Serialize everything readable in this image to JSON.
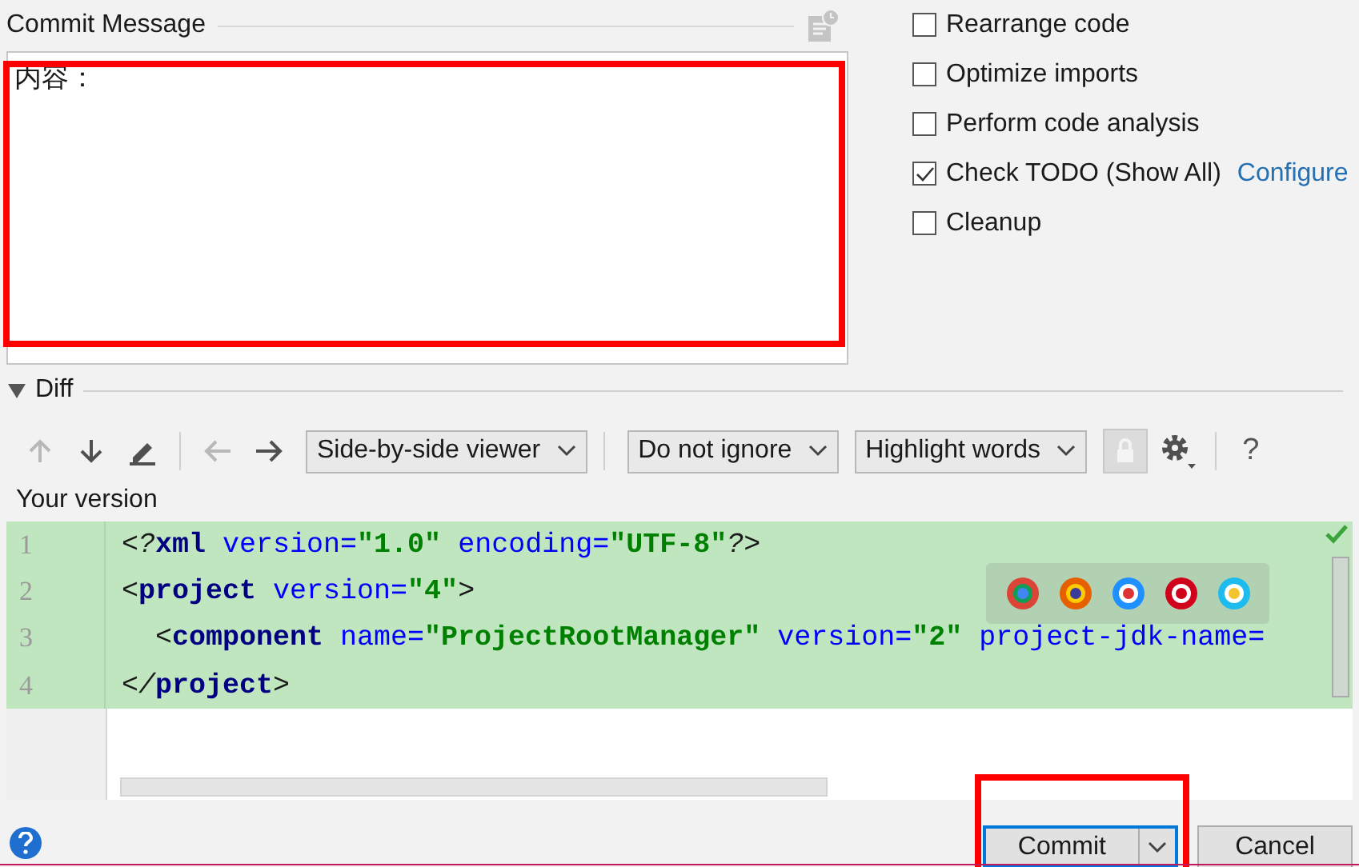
{
  "commit_message": {
    "label": "Commit Message",
    "value": "内容："
  },
  "options": [
    {
      "label": "Rearrange code",
      "checked": false
    },
    {
      "label": "Optimize imports",
      "checked": false
    },
    {
      "label": "Perform code analysis",
      "checked": false
    },
    {
      "label": "Check TODO (Show All)",
      "checked": true,
      "link": "Configure"
    },
    {
      "label": "Cleanup",
      "checked": false
    }
  ],
  "diff": {
    "title": "Diff",
    "expanded": true,
    "toolbar": [
      {
        "kind": "up",
        "disabled": true
      },
      {
        "kind": "down",
        "disabled": false
      },
      {
        "kind": "edit",
        "disabled": false
      },
      {
        "kind": "separator"
      },
      {
        "kind": "back",
        "disabled": true
      },
      {
        "kind": "forward",
        "disabled": false
      },
      {
        "kind": "dropdown",
        "label": "Side-by-side viewer"
      },
      {
        "kind": "separator"
      },
      {
        "kind": "dropdown",
        "label": "Do not ignore"
      },
      {
        "kind": "dropdown",
        "label": "Highlight words"
      },
      {
        "kind": "lock",
        "disabled": true
      },
      {
        "kind": "settings",
        "disabled": false
      },
      {
        "kind": "separator"
      },
      {
        "kind": "help",
        "label": "?"
      }
    ],
    "pane_title": "Your version",
    "lines": [
      {
        "number": "1",
        "tokens": [
          {
            "kind": "punct",
            "text": "<?"
          },
          {
            "kind": "tag",
            "text": "xml"
          },
          {
            "kind": "attr",
            "text": " version="
          },
          {
            "kind": "value",
            "text": "\"1.0\""
          },
          {
            "kind": "attr",
            "text": " encoding="
          },
          {
            "kind": "value",
            "text": "\"UTF-8\""
          },
          {
            "kind": "punct",
            "text": "?>"
          }
        ]
      },
      {
        "number": "2",
        "tokens": [
          {
            "kind": "punct",
            "text": "<"
          },
          {
            "kind": "tag",
            "text": "project"
          },
          {
            "kind": "attr",
            "text": " version="
          },
          {
            "kind": "value",
            "text": "\"4\""
          },
          {
            "kind": "punct",
            "text": ">"
          }
        ]
      },
      {
        "number": "3",
        "tokens": [
          {
            "kind": "punct",
            "text": "  <"
          },
          {
            "kind": "tag",
            "text": "component"
          },
          {
            "kind": "attr",
            "text": " name="
          },
          {
            "kind": "value",
            "text": "\"ProjectRootManager\""
          },
          {
            "kind": "attr",
            "text": " version="
          },
          {
            "kind": "value",
            "text": "\"2\""
          },
          {
            "kind": "attr",
            "text": " project-jdk-name="
          }
        ]
      },
      {
        "number": "4",
        "tokens": [
          {
            "kind": "punct",
            "text": "</"
          },
          {
            "kind": "tag",
            "text": "project"
          },
          {
            "kind": "punct",
            "text": ">"
          }
        ]
      }
    ]
  },
  "buttons": [
    {
      "label": "Commit",
      "kind": "split",
      "default": true
    },
    {
      "label": "Cancel",
      "kind": "plain",
      "default": false
    }
  ]
}
